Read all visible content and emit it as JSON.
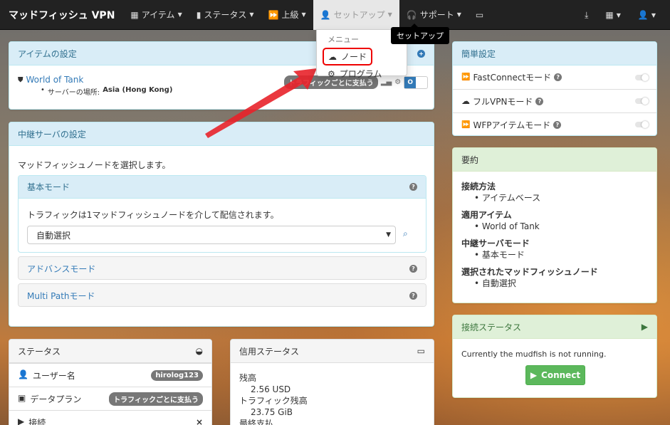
{
  "navbar": {
    "brand": "マッドフィッシュ VPN",
    "items": [
      {
        "label": "アイテム",
        "icon": "puzzle-icon"
      },
      {
        "label": "ステータス",
        "icon": "bar-chart-icon"
      },
      {
        "label": "上級",
        "icon": "fast-forward-icon"
      },
      {
        "label": "セットアップ",
        "icon": "user-icon"
      },
      {
        "label": "サポート",
        "icon": "headset-icon"
      }
    ],
    "right_icons": [
      "download-icon",
      "grid-icon",
      "user-icon"
    ]
  },
  "setup_dropdown": {
    "header": "メニュー",
    "items": [
      {
        "label": "ノード",
        "icon": "cloud-icon"
      },
      {
        "label": "プログラム",
        "icon": "gear-icon"
      }
    ],
    "tooltip": "セットアップ"
  },
  "item_settings": {
    "title": "アイテムの設定",
    "item_name": "World of Tank",
    "server_label": "サーバーの場所:",
    "server_value": "Asia (Hong Kong)",
    "badge": "トラフィックごとに支払う"
  },
  "relay": {
    "title": "中継サーバの設定",
    "intro": "マッドフィッシュノードを選択します。",
    "basic_title": "基本モード",
    "basic_desc": "トラフィックは1マッドフィッシュノードを介して配信されます。",
    "select_value": "自動選択",
    "advanced_title": "アドバンスモード",
    "multipath_title": "Multi Pathモード"
  },
  "status": {
    "title": "ステータス",
    "rows": [
      {
        "label": "ユーザー名",
        "value": "hirolog123"
      },
      {
        "label": "データプラン",
        "value": "トラフィックごとに支払う"
      },
      {
        "label": "接続",
        "value": "×"
      }
    ]
  },
  "credit": {
    "title": "信用ステータス",
    "balance_label": "残高",
    "balance_value": "2.56 USD",
    "traffic_label": "トラフィック残高",
    "traffic_value": "23.75 GiB",
    "last_label": "最終支払"
  },
  "quick": {
    "title": "簡単設定",
    "rows": [
      {
        "label": "FastConnectモード",
        "icon": "fast-forward-icon"
      },
      {
        "label": "フルVPNモード",
        "icon": "cloud-icon"
      },
      {
        "label": "WFPアイテムモード",
        "icon": "fast-forward-icon"
      }
    ]
  },
  "summary": {
    "title": "要約",
    "sections": [
      {
        "heading": "接続方法",
        "value": "アイテムベース"
      },
      {
        "heading": "適用アイテム",
        "value": "World of Tank"
      },
      {
        "heading": "中継サーバモード",
        "value": "基本モード"
      },
      {
        "heading": "選択されたマッドフィッシュノード",
        "value": "自動選択"
      }
    ]
  },
  "connection": {
    "title": "接続ステータス",
    "message": "Currently the mudfish is not running.",
    "button": "Connect"
  },
  "colors": {
    "navbar": "#222222",
    "info_heading": "#d9edf7",
    "success_heading": "#dff0d8",
    "link": "#337ab7",
    "connect_button": "#5cb85c",
    "highlight": "#ee0000"
  }
}
